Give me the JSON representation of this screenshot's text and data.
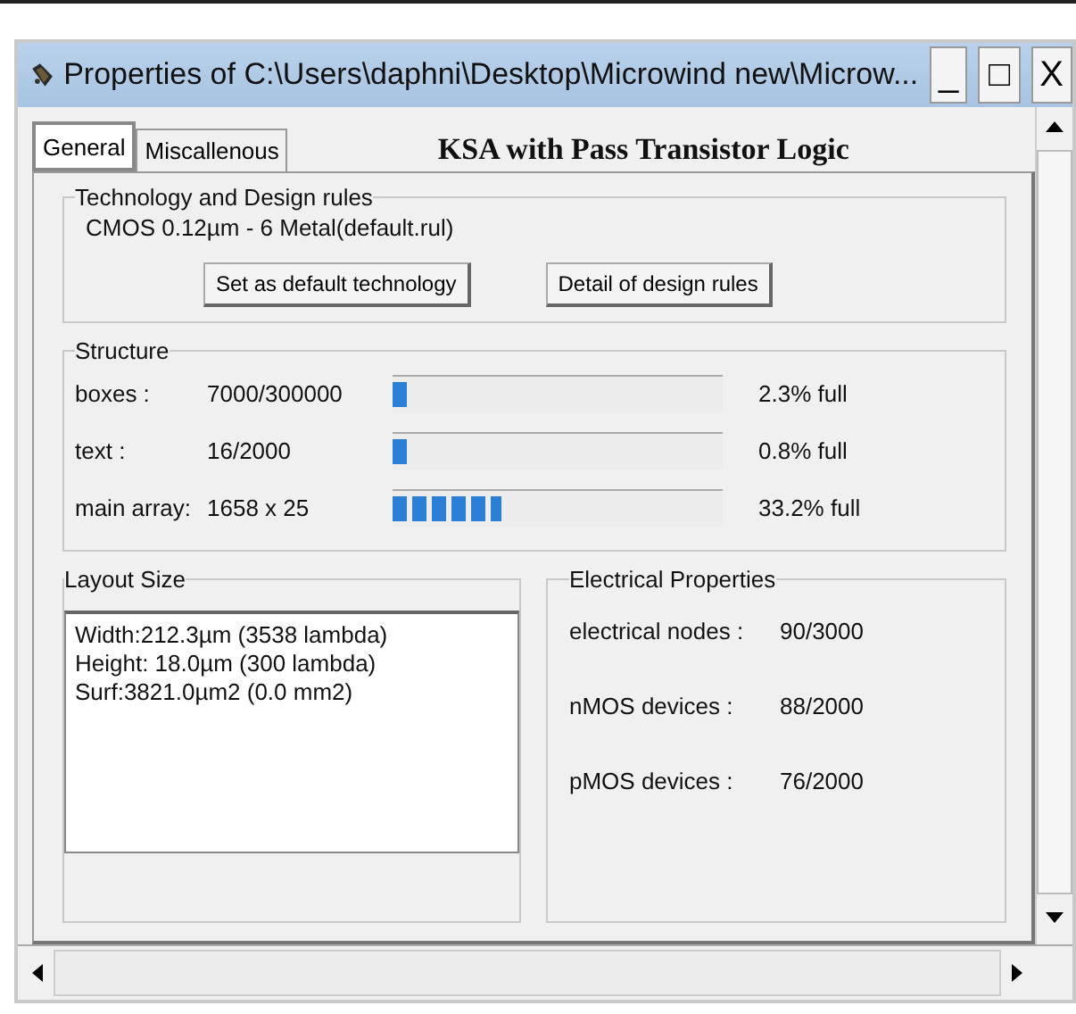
{
  "window": {
    "title": "Properties of C:\\Users\\daphni\\Desktop\\Microwind new\\Microw...",
    "controls": [
      "_",
      "□",
      "X"
    ]
  },
  "tabs": [
    {
      "label": "General",
      "selected": true
    },
    {
      "label": "Miscallenous",
      "selected": false
    }
  ],
  "heading": "KSA with Pass Transistor Logic",
  "technology": {
    "title": "Technology and Design rules",
    "value": "CMOS 0.12µm - 6 Metal(default.rul)",
    "buttons": [
      "Set as default technology",
      "Detail of design rules"
    ]
  },
  "structure": {
    "title": "Structure",
    "rows": [
      {
        "label": "boxes :",
        "value": "7000/300000",
        "level": 0.023,
        "reading": "2.3% full"
      },
      {
        "label": "text :",
        "value": "16/2000",
        "level": 0.008,
        "reading": "0.8% full"
      },
      {
        "label": "main array:",
        "value": "1658 x 25",
        "level": 0.332,
        "reading": "33.2% full"
      }
    ]
  },
  "layout_size": {
    "title": "Layout Size",
    "lines": [
      "Width:212.3µm (3538 lambda)",
      "Height: 18.0µm (300 lambda)",
      "Surf:3821.0µm2 (0.0 mm2)"
    ]
  },
  "electrical": {
    "title": "Electrical Properties",
    "rows": [
      {
        "label": "electrical nodes :",
        "value": "90/3000"
      },
      {
        "label": "nMOS devices :",
        "value": "88/2000"
      },
      {
        "label": "pMOS devices :",
        "value": "76/2000"
      }
    ]
  }
}
